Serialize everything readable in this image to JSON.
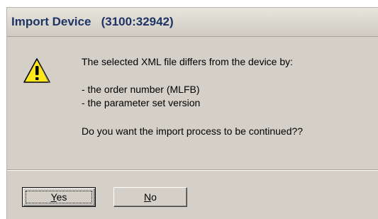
{
  "dialog": {
    "title": "Import Device   (3100:32942)",
    "icon": "warning-icon",
    "message_line1": "The selected XML file differs from the device by:",
    "difference_1": "- the order number (MLFB)",
    "difference_2": "- the parameter set version",
    "question": "Do you want the import process to be continued??"
  },
  "buttons": {
    "yes_accel": "Y",
    "yes_rest": "es",
    "no_accel": "N",
    "no_rest": "o"
  },
  "colors": {
    "dialog_face": "#d4d0c8",
    "title_text": "#1f3466",
    "warning_fill": "#ffe81a"
  }
}
